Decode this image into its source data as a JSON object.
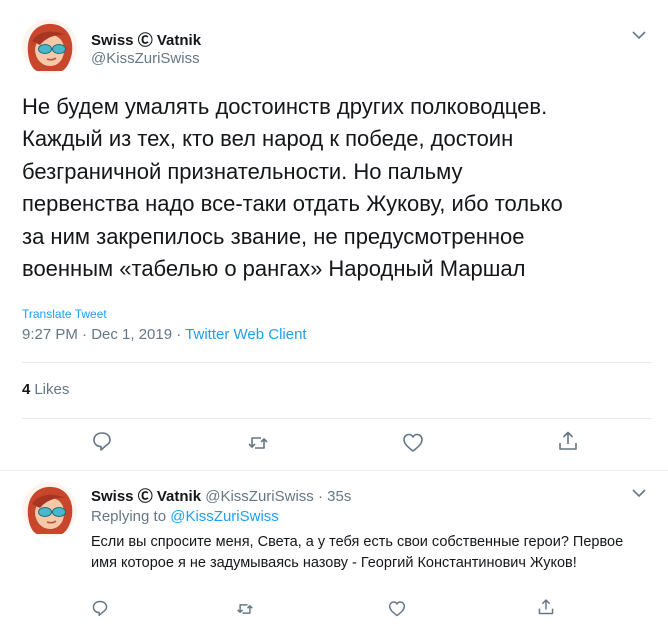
{
  "main_tweet": {
    "author_name": "Swiss Ⓒ Vatnik",
    "author_handle": "@KissZuriSwiss",
    "text": "Не будем умалять достоинств других полководцев.\nКаждый из тех, кто вел народ к победе, достоин\nбезграничной признательности. Но пальму\nпервенства надо все-таки отдать Жукову, ибо только\nза ним закрепилось звание, не предусмотренное\nвоенным «табелью о рангах» Народный Маршал",
    "translate_label": "Translate Tweet",
    "timestamp": "9:27 PM · Dec 1, 2019",
    "separator": " · ",
    "client": "Twitter Web Client",
    "likes_count": "4",
    "likes_label": "Likes"
  },
  "reply_tweet": {
    "author_name": "Swiss Ⓒ Vatnik",
    "author_handle": "@KissZuriSwiss",
    "dot": "·",
    "time": "35s",
    "replying_prefix": "Replying to",
    "replying_handle": "@KissZuriSwiss",
    "text": "Если вы спросите меня, Света, а у тебя есть свои собственные герои? Первое имя которое я не задумываясь назову - Георгий Константинович Жуков!"
  },
  "icons": {
    "reply": "reply-icon",
    "retweet": "retweet-icon",
    "like": "like-icon",
    "share": "share-icon",
    "menu": "chevron-down-icon"
  },
  "colors": {
    "link": "#1da1f2",
    "secondary_text": "#657786",
    "primary_text": "#14171a",
    "divider": "#e6ecf0",
    "avatar_hair": "#c8472c"
  }
}
